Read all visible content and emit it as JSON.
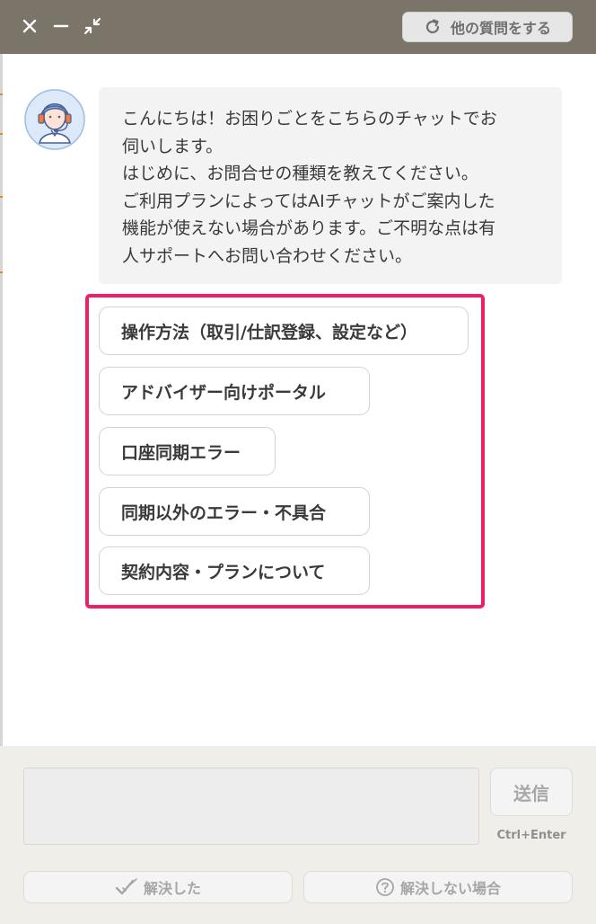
{
  "header": {
    "other_question_label": "他の質問をする",
    "icons": [
      "close-icon",
      "minimize-icon",
      "shrink-icon",
      "refresh-icon"
    ]
  },
  "chat": {
    "avatar_icon": "support-agent-avatar",
    "message_lines": [
      "こんにちは！お困りごとをこちらのチャットでお",
      "伺いします。",
      "はじめに、お問合せの種類を教えてください。",
      "ご利用プランによってはAIチャットがご案内した",
      "機能が使えない場合があります。ご不明な点は有",
      "人サポートへお問い合わせください。"
    ],
    "options": [
      "操作方法（取引/仕訳登録、設定など）",
      "アドバイザー向けポータル",
      "口座同期エラー",
      "同期以外のエラー・不具合",
      "契約内容・プランについて"
    ],
    "highlight_color": "#ef1f63"
  },
  "footer": {
    "input_value": "",
    "send_label": "送信",
    "shortcut_hint": "Ctrl+Enter",
    "resolved_label": "解決した",
    "unresolved_label": "解決しない場合",
    "icons": [
      "check-icon",
      "question-circle-icon"
    ]
  },
  "colors": {
    "header_bg": "#7b7468",
    "footer_bg": "#efeee9",
    "bubble_bg": "#f4f3f3"
  }
}
